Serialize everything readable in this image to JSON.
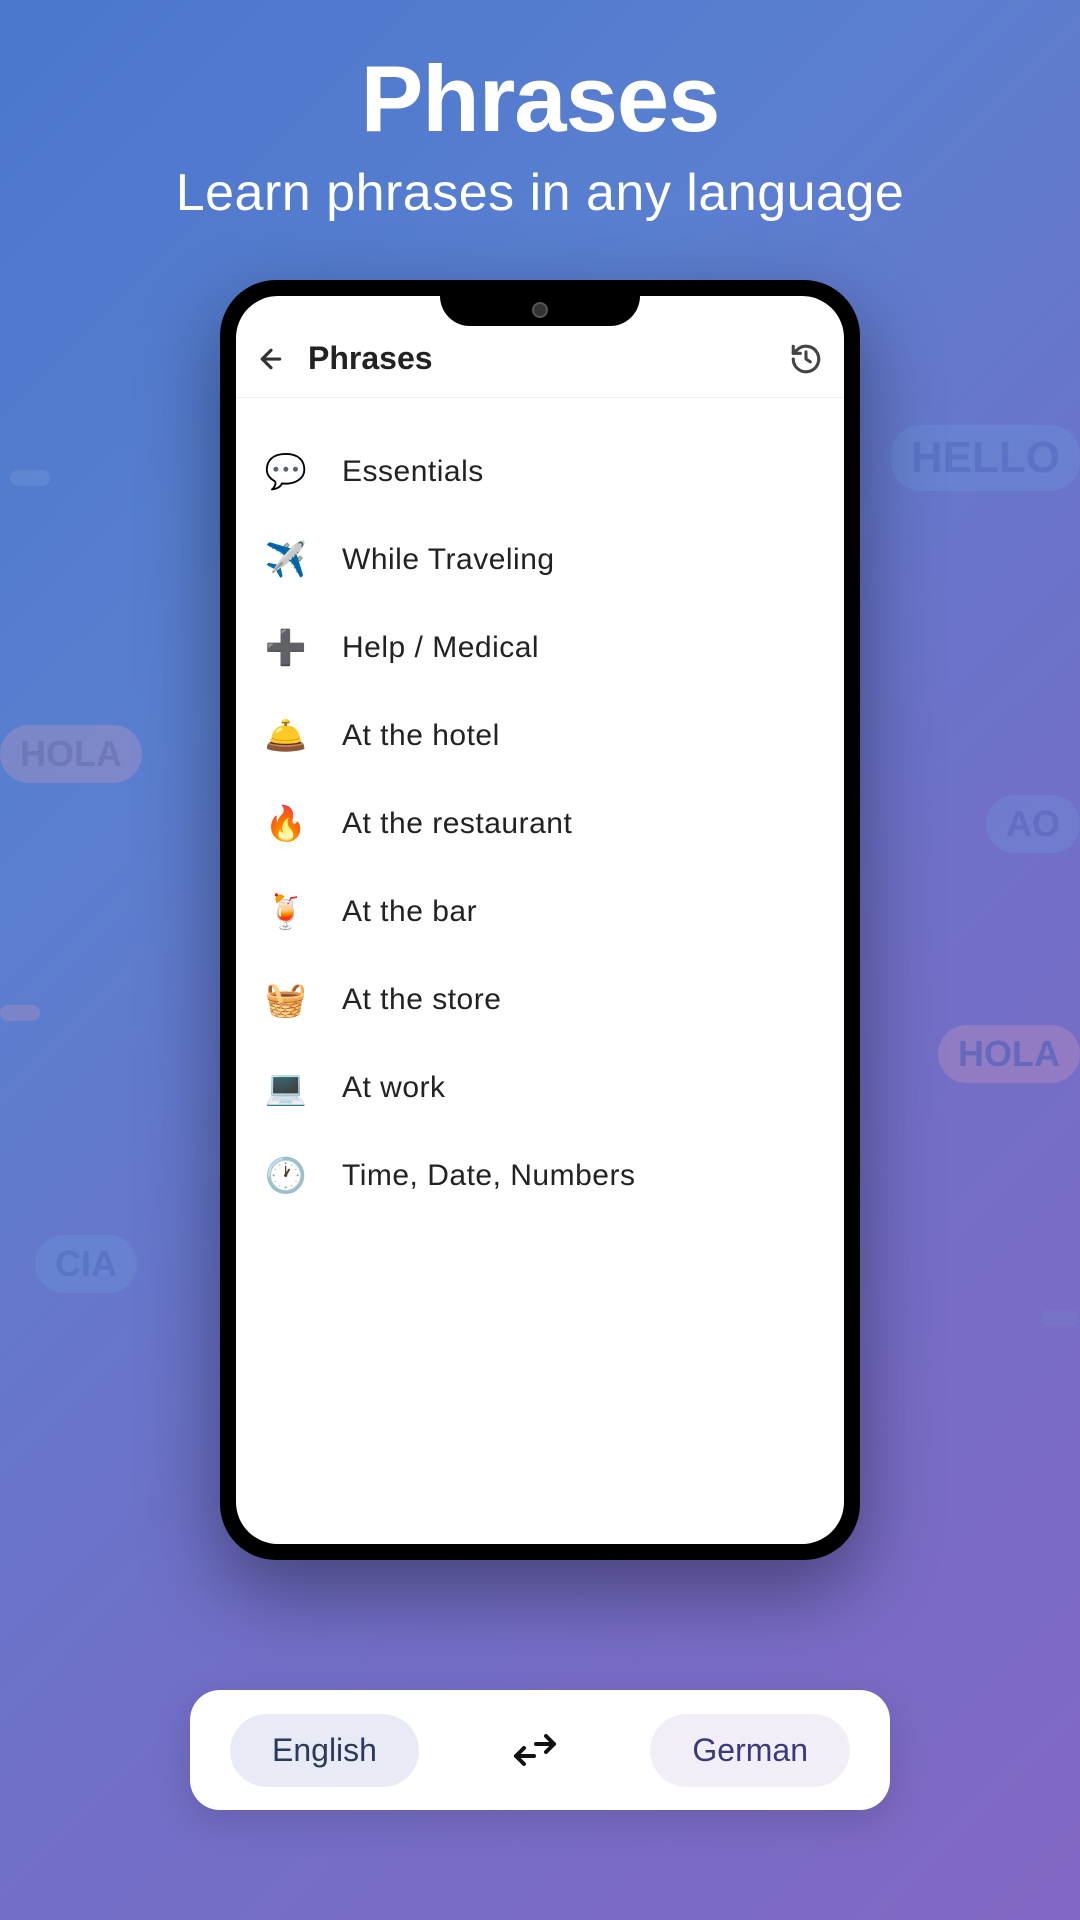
{
  "hero": {
    "title": "Phrases",
    "subtitle": "Learn phrases in any language"
  },
  "app": {
    "title": "Phrases"
  },
  "categories": [
    {
      "icon": "💬",
      "label": "Essentials"
    },
    {
      "icon": "✈️",
      "label": "While Traveling"
    },
    {
      "icon": "➕",
      "label": "Help / Medical"
    },
    {
      "icon": "🛎️",
      "label": "At the hotel"
    },
    {
      "icon": "🔥",
      "label": "At the restaurant"
    },
    {
      "icon": "🍹",
      "label": "At the bar"
    },
    {
      "icon": "🧺",
      "label": "At the store"
    },
    {
      "icon": "💻",
      "label": "At work"
    },
    {
      "icon": "🕐",
      "label": "Time, Date, Numbers"
    }
  ],
  "languageBar": {
    "source": "English",
    "target": "German"
  },
  "bubbles": {
    "b2": "HELLO",
    "b3": "HOLA",
    "b4": "AO",
    "b6": "HOLA",
    "b7": "CIA"
  }
}
